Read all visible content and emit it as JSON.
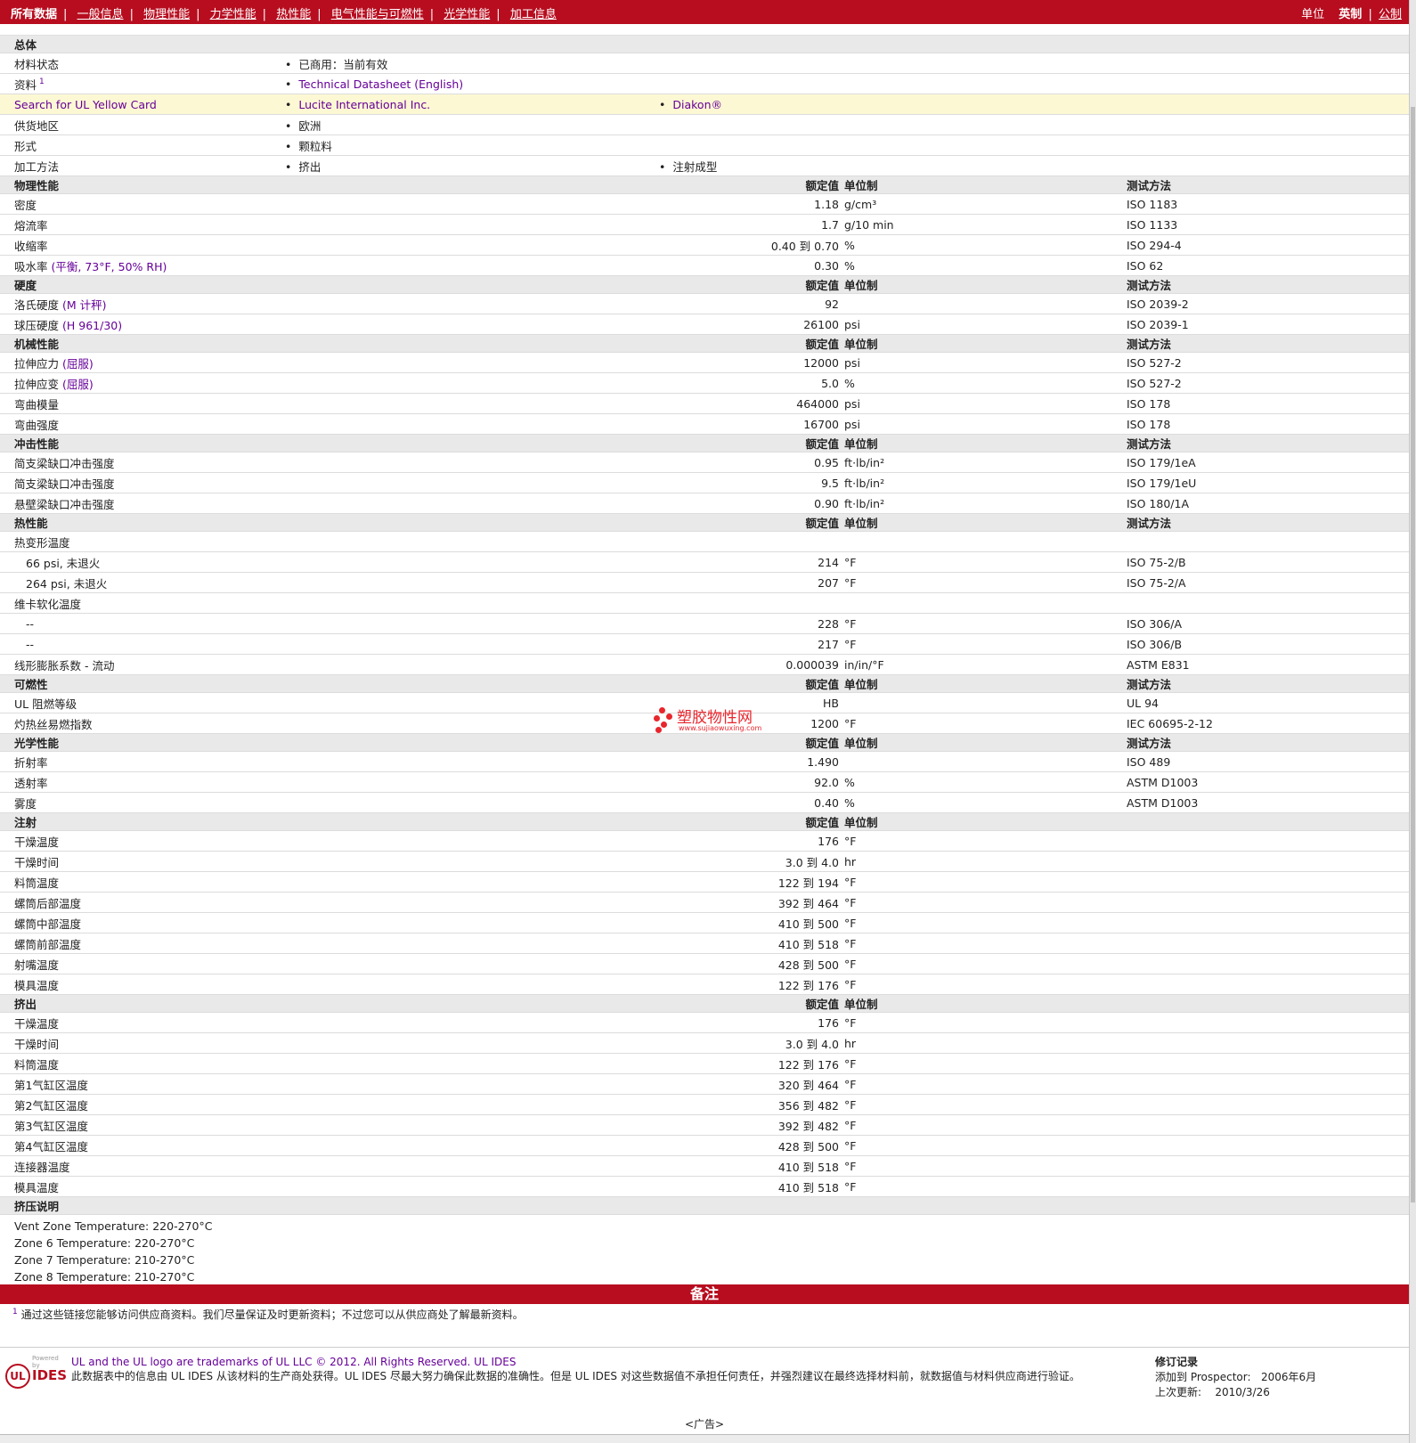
{
  "nav": {
    "all": "所有数据",
    "links": [
      "一般信息",
      "物理性能",
      "力学性能",
      "热性能",
      "电气性能与可燃性",
      "光学性能",
      "加工信息"
    ],
    "units_label": "单位",
    "unit_imperial": "英制",
    "unit_metric": "公制"
  },
  "general": {
    "title": "总体",
    "rows": [
      {
        "label": "材料状态",
        "items": [
          "已商用：当前有效"
        ]
      },
      {
        "label": "资料",
        "sup": "1",
        "items": [
          "Technical Datasheet (English)"
        ]
      },
      {
        "label": "Search for UL Yellow Card",
        "items": [
          "Lucite International Inc.",
          "Diakon®"
        ]
      },
      {
        "label": "供货地区",
        "items": [
          "欧洲"
        ]
      },
      {
        "label": "形式",
        "items": [
          "颗粒料"
        ]
      },
      {
        "label": "加工方法",
        "items": [
          "挤出",
          "注射成型"
        ]
      }
    ]
  },
  "headers": {
    "value": "额定值",
    "unit": "单位制",
    "method": "测试方法"
  },
  "sections": [
    {
      "title": "物理性能",
      "show_method": true,
      "rows": [
        {
          "label": "密度",
          "value": "1.18",
          "unit": "g/cm³",
          "method": "ISO 1183"
        },
        {
          "label": "熔流率",
          "value": "1.7",
          "unit": "g/10 min",
          "method": "ISO 1133"
        },
        {
          "label": "收缩率",
          "value": "0.40 到  0.70",
          "unit": "%",
          "method": "ISO 294-4"
        },
        {
          "label": "吸水率",
          "cond": "(平衡, 73°F, 50% RH)",
          "value": "0.30",
          "unit": "%",
          "method": "ISO 62"
        }
      ]
    },
    {
      "title": "硬度",
      "show_method": true,
      "rows": [
        {
          "label": "洛氏硬度",
          "cond": "(M 计秤)",
          "value": "92",
          "unit": "",
          "method": "ISO 2039-2"
        },
        {
          "label": "球压硬度",
          "cond": "(H 961/30)",
          "value": "26100",
          "unit": "psi",
          "method": "ISO 2039-1"
        }
      ]
    },
    {
      "title": "机械性能",
      "show_method": true,
      "rows": [
        {
          "label": "拉伸应力",
          "cond": "(屈服)",
          "value": "12000",
          "unit": "psi",
          "method": "ISO 527-2"
        },
        {
          "label": "拉伸应变",
          "cond": "(屈服)",
          "value": "5.0",
          "unit": "%",
          "method": "ISO 527-2"
        },
        {
          "label": "弯曲模量",
          "value": "464000",
          "unit": "psi",
          "method": "ISO 178"
        },
        {
          "label": "弯曲强度",
          "value": "16700",
          "unit": "psi",
          "method": "ISO 178"
        }
      ]
    },
    {
      "title": "冲击性能",
      "show_method": true,
      "rows": [
        {
          "label": "简支梁缺口冲击强度",
          "value": "0.95",
          "unit": "ft·lb/in²",
          "method": "ISO 179/1eA"
        },
        {
          "label": "简支梁缺口冲击强度",
          "value": "9.5",
          "unit": "ft·lb/in²",
          "method": "ISO 179/1eU"
        },
        {
          "label": "悬壁梁缺口冲击强度",
          "value": "0.90",
          "unit": "ft·lb/in²",
          "method": "ISO 180/1A"
        }
      ]
    },
    {
      "title": "热性能",
      "show_method": true,
      "rows": [
        {
          "label": "热变形温度",
          "value": "",
          "unit": "",
          "method": ""
        },
        {
          "label": "66 psi, 未退火",
          "indent": true,
          "value": "214",
          "unit": "°F",
          "method": "ISO 75-2/B"
        },
        {
          "label": "264 psi, 未退火",
          "indent": true,
          "value": "207",
          "unit": "°F",
          "method": "ISO 75-2/A"
        },
        {
          "label": "维卡软化温度",
          "value": "",
          "unit": "",
          "method": ""
        },
        {
          "label": "--",
          "indent": true,
          "value": "228",
          "unit": "°F",
          "method": "ISO 306/A"
        },
        {
          "label": "--",
          "indent": true,
          "value": "217",
          "unit": "°F",
          "method": "ISO 306/B"
        },
        {
          "label": "线形膨胀系数  - 流动",
          "value": "0.000039",
          "unit": "in/in/°F",
          "method": "ASTM E831"
        }
      ]
    },
    {
      "title": "可燃性",
      "show_method": true,
      "rows": [
        {
          "label": "UL 阻燃等级",
          "value": "HB",
          "unit": "",
          "method": "UL 94"
        },
        {
          "label": "灼热丝易燃指数",
          "value": "1200",
          "unit": "°F",
          "method": "IEC 60695-2-12"
        }
      ]
    },
    {
      "title": "光学性能",
      "show_method": true,
      "rows": [
        {
          "label": "折射率",
          "value": "1.490",
          "unit": "",
          "method": "ISO 489"
        },
        {
          "label": "透射率",
          "value": "92.0",
          "unit": "%",
          "method": "ASTM D1003"
        },
        {
          "label": "雾度",
          "value": "0.40",
          "unit": "%",
          "method": "ASTM D1003"
        }
      ]
    },
    {
      "title": "注射",
      "show_method": false,
      "rows": [
        {
          "label": "干燥温度",
          "value": "176",
          "unit": "°F",
          "method": ""
        },
        {
          "label": "干燥时间",
          "value": "3.0 到  4.0",
          "unit": "hr",
          "method": ""
        },
        {
          "label": "料筒温度",
          "value": "122 到  194",
          "unit": "°F",
          "method": ""
        },
        {
          "label": "螺筒后部温度",
          "value": "392 到  464",
          "unit": "°F",
          "method": ""
        },
        {
          "label": "螺筒中部温度",
          "value": "410 到  500",
          "unit": "°F",
          "method": ""
        },
        {
          "label": "螺筒前部温度",
          "value": "410 到  518",
          "unit": "°F",
          "method": ""
        },
        {
          "label": "射嘴温度",
          "value": "428 到  500",
          "unit": "°F",
          "method": ""
        },
        {
          "label": "模具温度",
          "value": "122 到  176",
          "unit": "°F",
          "method": ""
        }
      ]
    },
    {
      "title": "挤出",
      "show_method": false,
      "rows": [
        {
          "label": "干燥温度",
          "value": "176",
          "unit": "°F",
          "method": ""
        },
        {
          "label": "干燥时间",
          "value": "3.0 到  4.0",
          "unit": "hr",
          "method": ""
        },
        {
          "label": "料筒温度",
          "value": "122 到  176",
          "unit": "°F",
          "method": ""
        },
        {
          "label": "第1气缸区温度",
          "value": "320 到  464",
          "unit": "°F",
          "method": ""
        },
        {
          "label": "第2气缸区温度",
          "value": "356 到  482",
          "unit": "°F",
          "method": ""
        },
        {
          "label": "第3气缸区温度",
          "value": "392 到  482",
          "unit": "°F",
          "method": ""
        },
        {
          "label": "第4气缸区温度",
          "value": "428 到  500",
          "unit": "°F",
          "method": ""
        },
        {
          "label": "连接器温度",
          "value": "410 到  518",
          "unit": "°F",
          "method": ""
        },
        {
          "label": "模具温度",
          "value": "410 到  518",
          "unit": "°F",
          "method": ""
        }
      ]
    }
  ],
  "extrusion_notes": {
    "title": "挤压说明",
    "lines": [
      "Vent Zone Temperature: 220-270°C",
      "Zone 6 Temperature: 220-270°C",
      "Zone 7 Temperature: 210-270°C",
      "Zone 8 Temperature: 210-270°C"
    ]
  },
  "remarks": {
    "title": "备注",
    "footnote_num": "1",
    "footnote": "通过这些链接您能够访问供应商资料。我们尽量保证及时更新资料；不过您可以从供应商处了解最新资料。"
  },
  "footer": {
    "powered": "Powered by",
    "ides": "IDES",
    "trademark": "UL and the UL logo are trademarks of UL LLC © 2012. All Rights Reserved. UL IDES",
    "disclaimer": "此数据表中的信息由 UL IDES 从该材料的生产商处获得。UL IDES 尽最大努力确保此数据的准确性。但是 UL IDES 对这些数据值不承担任何责任，并强烈建议在最终选择材料前，就数据值与材料供应商进行验证。",
    "revision_title": "修订记录",
    "added_label": "添加到 Prospector:",
    "added_value": "2006年6月",
    "updated_label": "上次更新:",
    "updated_value": "2010/3/26",
    "ad": "<广告>"
  },
  "watermark": {
    "text": "塑胶物性网",
    "url": "www.sujiaowuxing.com"
  },
  "colors": {
    "brand_red": "#b70d1f",
    "section_bg": "#e9e9e9",
    "highlight_bg": "#fdf8d4",
    "link_purple": "#660099"
  }
}
